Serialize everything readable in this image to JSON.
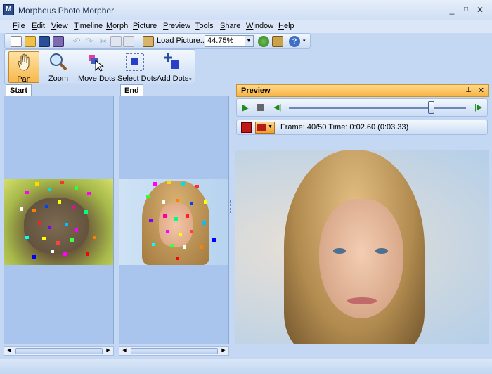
{
  "window": {
    "title": "Morpheus Photo Morpher",
    "minimize": "_",
    "maximize": "□",
    "close": "✕"
  },
  "menu": [
    {
      "label": "File",
      "u": "F",
      "rest": "ile"
    },
    {
      "label": "Edit",
      "u": "E",
      "rest": "dit"
    },
    {
      "label": "View",
      "u": "V",
      "rest": "iew"
    },
    {
      "label": "Timeline",
      "u": "T",
      "rest": "imeline"
    },
    {
      "label": "Morph",
      "u": "M",
      "rest": "orph"
    },
    {
      "label": "Picture",
      "u": "P",
      "rest": "icture"
    },
    {
      "label": "Preview",
      "u": "P",
      "rest": "review"
    },
    {
      "label": "Tools",
      "u": "T",
      "rest": "ools"
    },
    {
      "label": "Share",
      "u": "S",
      "rest": "hare"
    },
    {
      "label": "Window",
      "u": "W",
      "rest": "indow"
    },
    {
      "label": "Help",
      "u": "H",
      "rest": "elp"
    }
  ],
  "toolbar": {
    "load_picture": "Load Picture...",
    "zoom": "44.75%",
    "icons": [
      "new-icon",
      "open-icon",
      "save-icon",
      "save-all-icon",
      "undo-icon",
      "redo-icon",
      "cut-icon",
      "copy-icon",
      "paste-icon",
      "load-picture-icon",
      "globe-icon",
      "export-icon",
      "help-icon"
    ]
  },
  "tools": [
    {
      "label": "Pan",
      "icon": "hand-icon",
      "active": true
    },
    {
      "label": "Zoom",
      "icon": "magnifier-icon",
      "active": false
    },
    {
      "label": "Move Dots",
      "icon": "move-dots-icon",
      "active": false
    },
    {
      "label": "Select Dots",
      "icon": "select-dots-icon",
      "active": false
    },
    {
      "label": "Add Dots",
      "icon": "add-dots-icon",
      "active": false
    }
  ],
  "panels": {
    "start": "Start",
    "end": "End"
  },
  "preview": {
    "title": "Preview",
    "frame_info": "Frame: 40/50 Time: 0:02.60 (0:03.33)",
    "slider_fraction": 0.8
  },
  "colors": {
    "accent_orange": "#f7b444",
    "panel_blue": "#a9c5ee"
  }
}
